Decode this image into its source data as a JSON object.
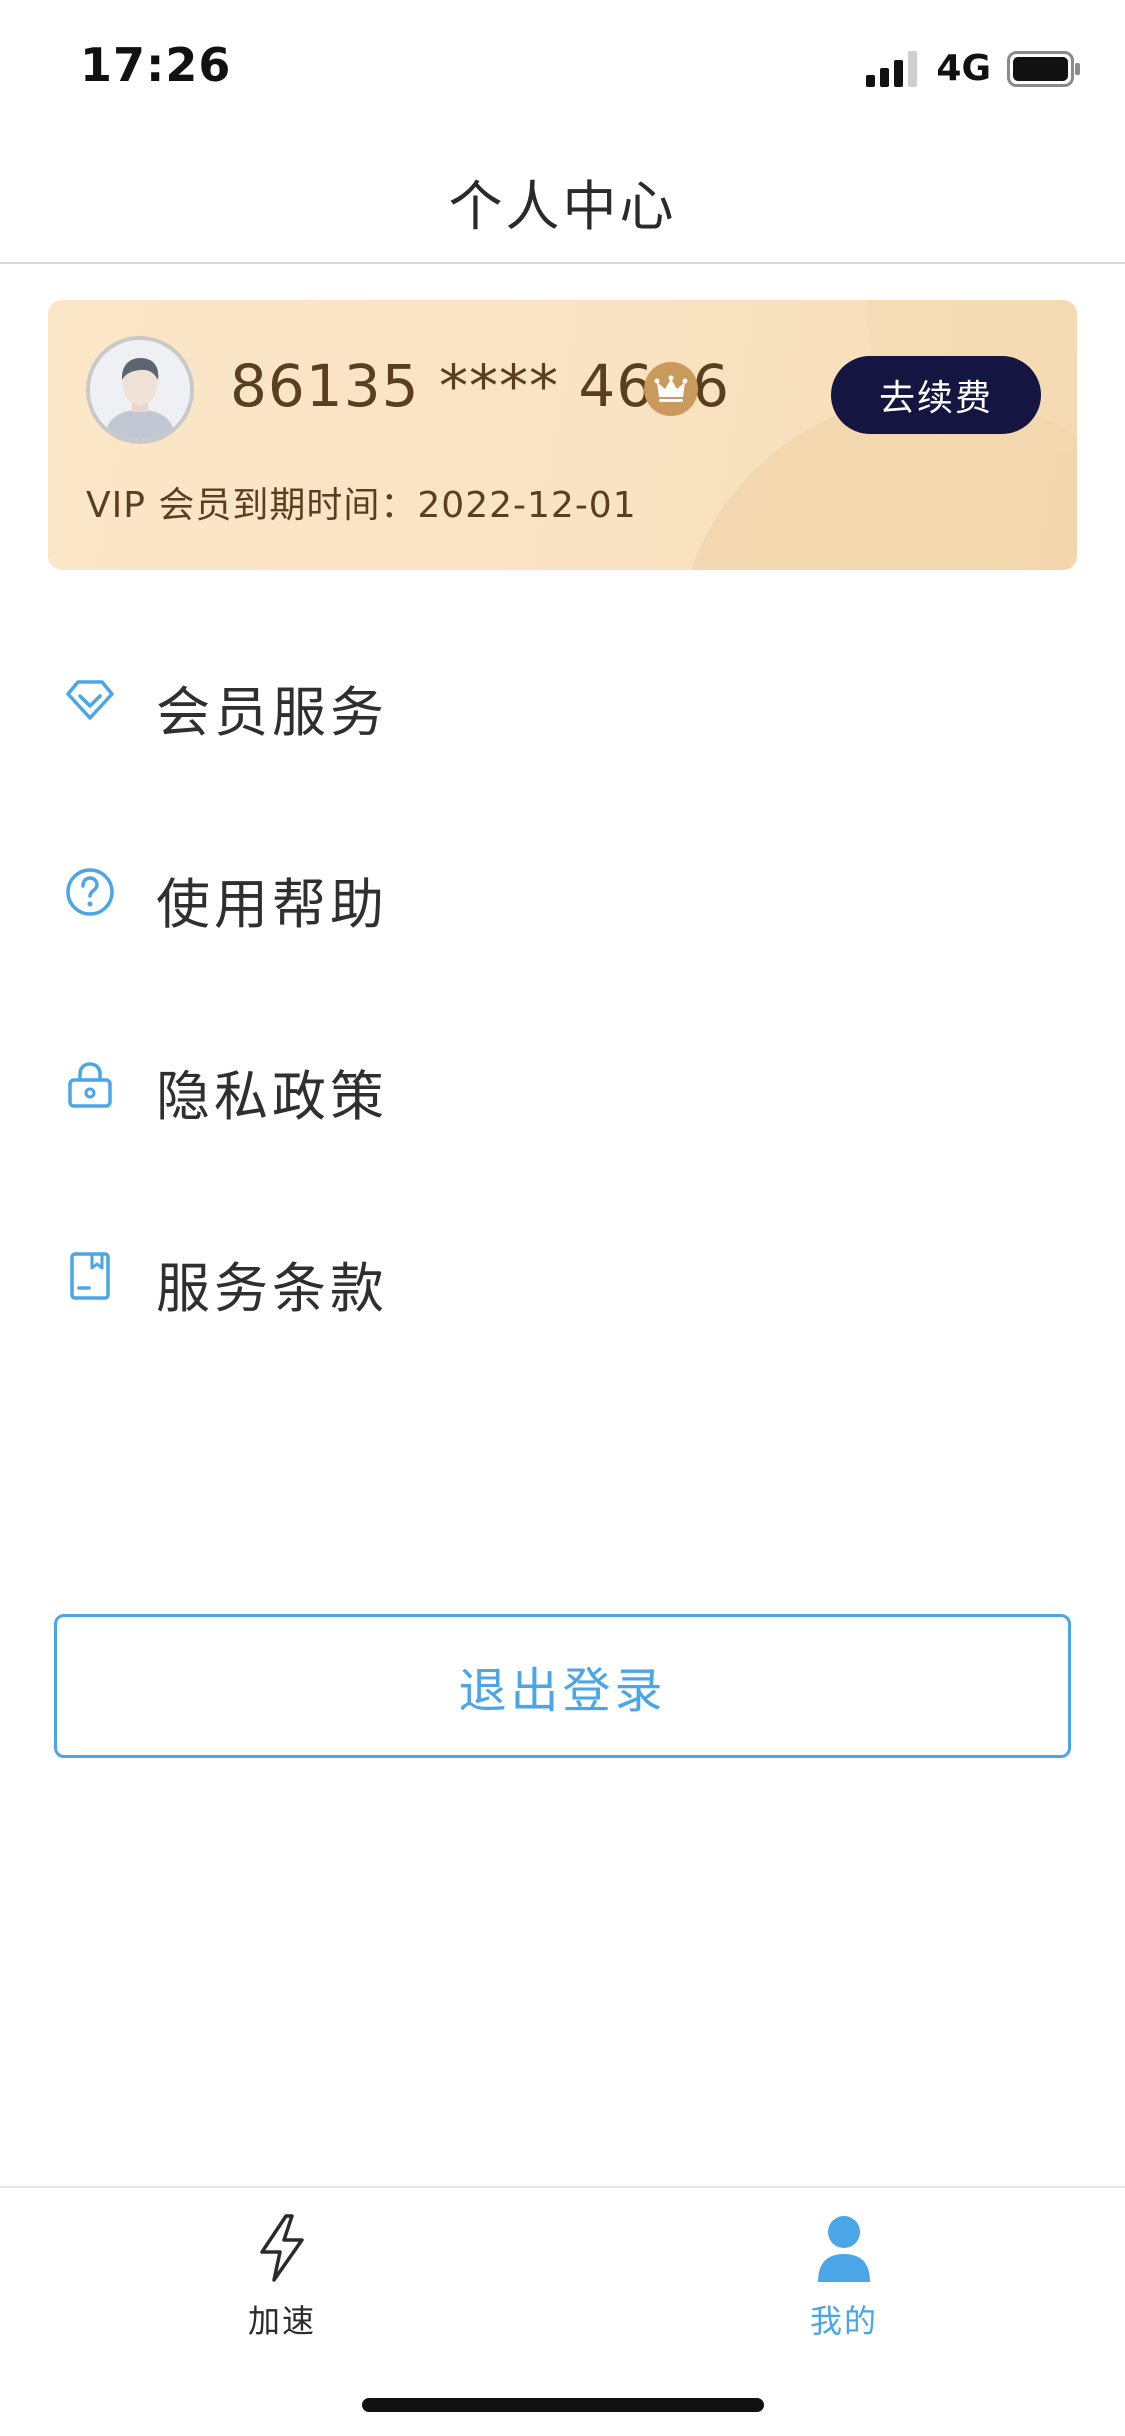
{
  "status_bar": {
    "time": "17:26",
    "network": "4G",
    "signal_icon": "signal-bars-icon",
    "battery_icon": "battery-icon"
  },
  "header": {
    "title": "个人中心"
  },
  "profile_card": {
    "phone": "86135 **** 4616",
    "vip_badge_icon": "crown-icon",
    "renew_label": "去续费",
    "expiry_text": "VIP 会员到期时间：2022-12-01",
    "colors": {
      "card_bg": "#fbe6c8",
      "text": "#5a3f1e",
      "button_bg": "#141541"
    }
  },
  "menu": [
    {
      "label": "会员服务",
      "icon": "diamond-icon"
    },
    {
      "label": "使用帮助",
      "icon": "question-circle-icon"
    },
    {
      "label": "隐私政策",
      "icon": "lock-icon"
    },
    {
      "label": "服务条款",
      "icon": "document-icon"
    }
  ],
  "logout": {
    "label": "退出登录"
  },
  "tab_bar": {
    "tabs": [
      {
        "label": "加速",
        "icon": "lightning-icon",
        "active": false
      },
      {
        "label": "我的",
        "icon": "user-icon",
        "active": true
      }
    ]
  },
  "colors": {
    "accent": "#4aa6e6",
    "text": "#2f2f2f",
    "divider": "#d9d9d9"
  }
}
